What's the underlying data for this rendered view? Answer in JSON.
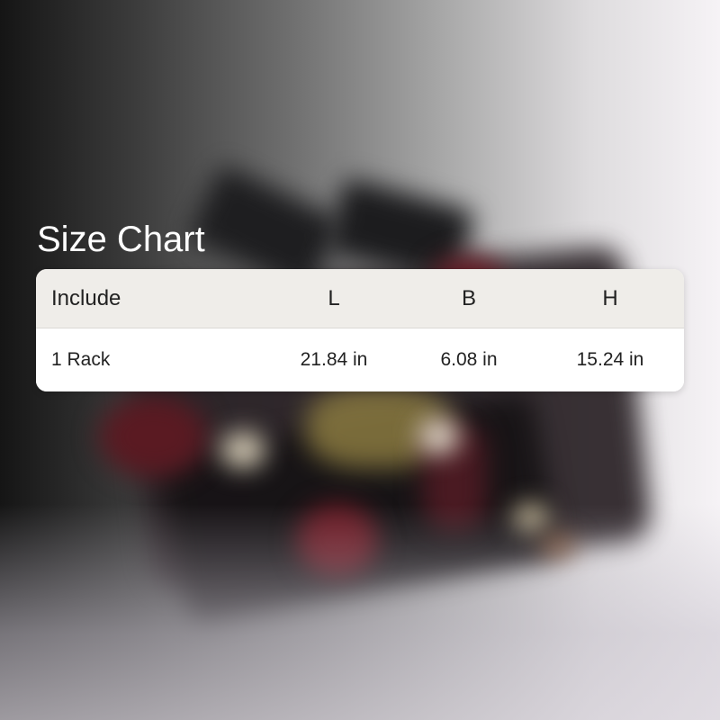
{
  "title": "Size Chart",
  "table": {
    "headers": [
      "Include",
      "L",
      "B",
      "H"
    ],
    "rows": [
      [
        "1 Rack",
        "21.84 in",
        "6.08 in",
        "15.24 in"
      ]
    ]
  }
}
